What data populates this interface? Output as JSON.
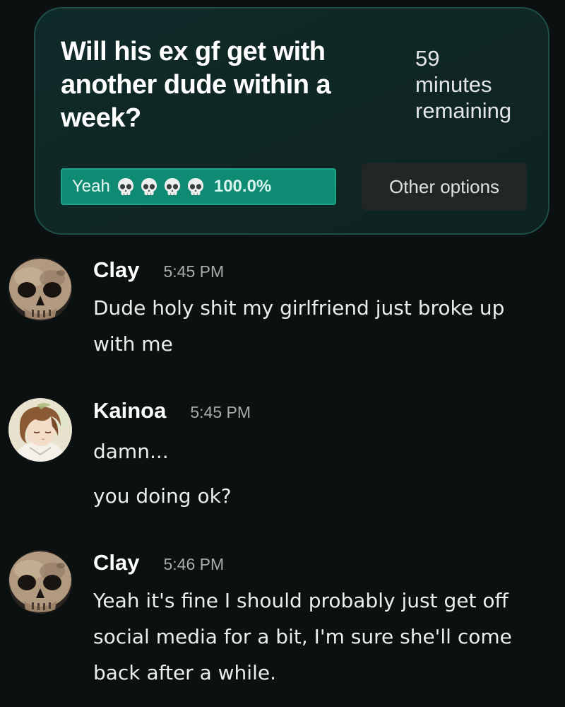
{
  "poll": {
    "question": "Will his ex gf get with another dude within a week?",
    "timer": [
      "59",
      "minutes",
      "remaining"
    ],
    "option": {
      "label": "Yeah",
      "emoji": [
        "skull-emoji",
        "skull-emoji",
        "skull-emoji",
        "skull-emoji"
      ],
      "percent": "100.0%"
    },
    "other_options_label": "Other options"
  },
  "messages": [
    {
      "author": "Clay",
      "time": "5:45 PM",
      "avatar": "skull-avatar",
      "lines": [
        "Dude holy shit my girlfriend just broke up with me"
      ]
    },
    {
      "author": "Kainoa",
      "time": "5:45 PM",
      "avatar": "anime-boy-avatar",
      "lines": [
        "damn...",
        "you doing ok?"
      ]
    },
    {
      "author": "Clay",
      "time": "5:46 PM",
      "avatar": "skull-avatar",
      "lines": [
        "Yeah it's fine I should probably just get off social media for a bit, I'm sure she'll come back after a while."
      ]
    }
  ],
  "colors": {
    "background": "#0b1010",
    "card": "#0f2624",
    "card_border": "#1f5048",
    "option_fill": "#0f8b74",
    "button": "#222626"
  }
}
